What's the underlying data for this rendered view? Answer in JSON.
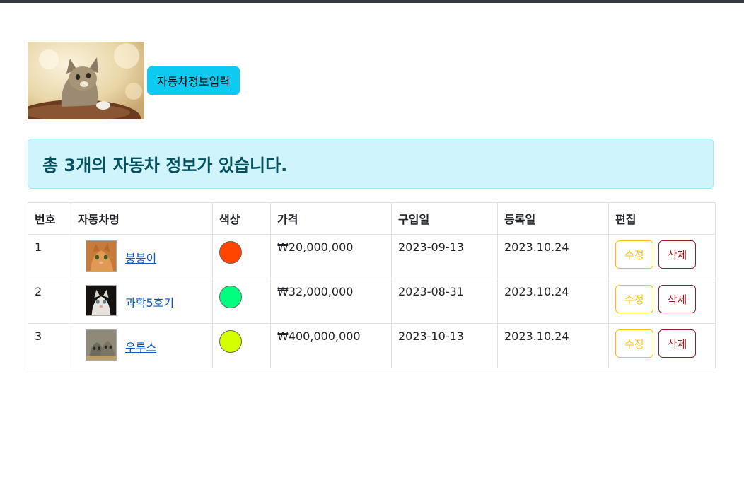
{
  "header": {
    "input_button_label": "자동차정보입력"
  },
  "alert": {
    "message": "총 3개의 자동차 정보가 있습니다."
  },
  "table": {
    "headers": [
      "번호",
      "자동차명",
      "색상",
      "가격",
      "구입일",
      "등록일",
      "편집"
    ],
    "rows": [
      {
        "no": "1",
        "name": "붕붕이",
        "color": "#ff4500",
        "price": "₩20,000,000",
        "purchased": "2023-09-13",
        "registered": "2023.10.24",
        "edit": "수정",
        "delete": "삭제"
      },
      {
        "no": "2",
        "name": "과학5호기",
        "color": "#00ff7f",
        "price": "₩32,000,000",
        "purchased": "2023-08-31",
        "registered": "2023.10.24",
        "edit": "수정",
        "delete": "삭제"
      },
      {
        "no": "3",
        "name": "우루스",
        "color": "#d4ff00",
        "price": "₩400,000,000",
        "purchased": "2023-10-13",
        "registered": "2023.10.24",
        "edit": "수정",
        "delete": "삭제"
      }
    ]
  }
}
